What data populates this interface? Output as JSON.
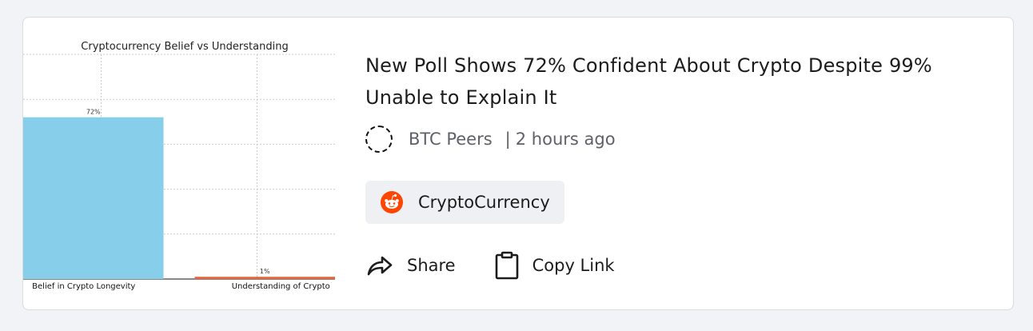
{
  "chart_data": {
    "type": "bar",
    "title": "Cryptocurrency Belief vs Understanding",
    "categories": [
      "Belief in Crypto Longevity",
      "Understanding of Crypto"
    ],
    "values": [
      72,
      1
    ],
    "data_labels": [
      "72%",
      "1%"
    ],
    "ylim": [
      0,
      100
    ],
    "grid": true,
    "colors": [
      "#87ceeb",
      "#e8653a"
    ]
  },
  "article": {
    "headline": "New Poll Shows 72% Confident About Crypto Despite 99% Unable to Explain It",
    "author": "BTC Peers",
    "separator": "|",
    "time": "2 hours ago"
  },
  "community": {
    "name": "CryptoCurrency",
    "icon": "reddit-icon",
    "icon_color": "#ff4500"
  },
  "actions": {
    "share_label": "Share",
    "share_icon": "share-arrow-icon",
    "copy_label": "Copy Link",
    "copy_icon": "clipboard-icon"
  }
}
